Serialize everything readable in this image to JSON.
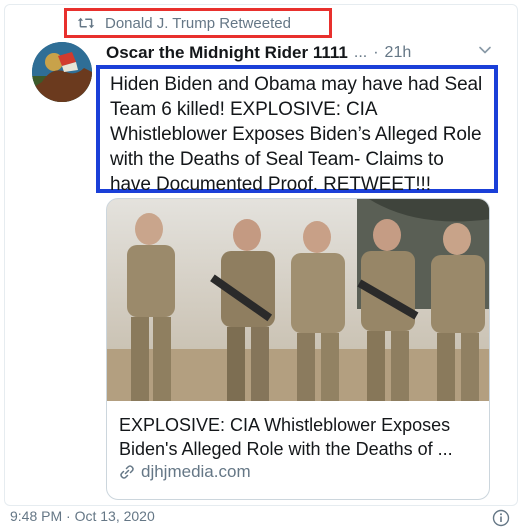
{
  "retweet": {
    "icon": "retweet-icon",
    "label": "Donald J. Trump Retweeted",
    "highlight_color": "#e8302d"
  },
  "author": {
    "name": "Oscar the Midnight Rider 1111",
    "truncation": "...",
    "separator": "·",
    "time": "21h",
    "menu_icon": "chevron-down-icon"
  },
  "tweet": {
    "lines": [
      "Hiden Biden and Obama may have had Seal",
      "Team 6 killed! EXPLOSIVE: CIA",
      "Whistleblower Exposes Biden’s Alleged Role",
      "with the Deaths of Seal Team- Claims to",
      "have Documented Proof. RETWEET!!!"
    ],
    "highlight_color": "#1a3fd8"
  },
  "link_card": {
    "image_icon": "soldiers-photo",
    "title_lines": [
      "EXPLOSIVE: CIA Whistleblower Exposes",
      "Biden's Alleged Role with the Deaths of ..."
    ],
    "domain_icon": "link-icon",
    "domain": "djhjmedia.com"
  },
  "footer": {
    "timestamp": "9:48 PM · Oct 13, 2020",
    "info_icon": "info-icon"
  },
  "colors": {
    "text_primary": "#14171a",
    "text_secondary": "#657786",
    "border": "#ccd6dd"
  }
}
